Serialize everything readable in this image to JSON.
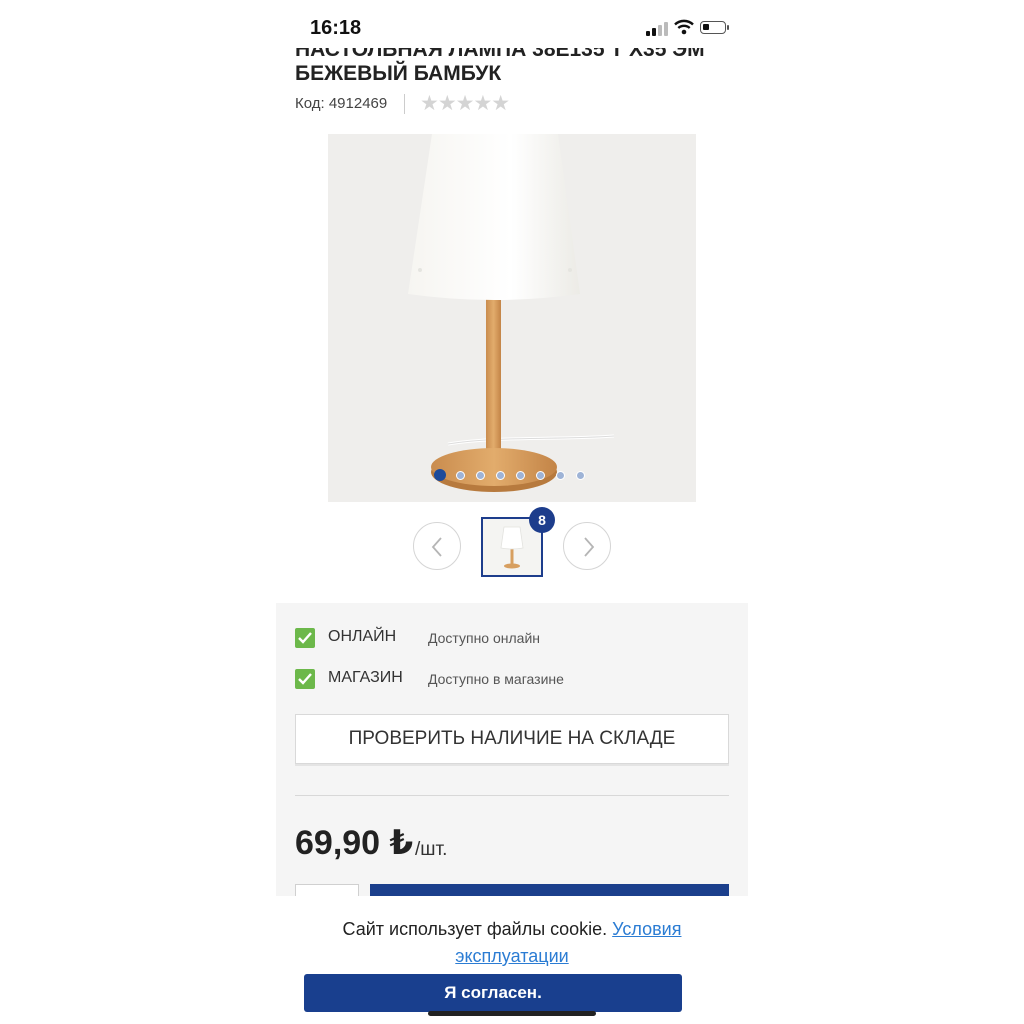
{
  "status_bar": {
    "time": "16:18"
  },
  "product": {
    "title_partial": "НАСТОЛЬНАЯ ЛАМПА 38Е135 Т Х35 ЭМ",
    "title": "БЕЖЕВЫЙ БАМБУК",
    "code": "Код: 4912469",
    "rating": "★★★★★",
    "rating_value": 0,
    "rating_max": 5,
    "image_icon": "table-lamp-image",
    "gallery": {
      "active_index": 0,
      "dot_count": 8,
      "image_count": "8"
    }
  },
  "availability": {
    "items": [
      {
        "label": "ОНЛАЙН",
        "description": "Доступно онлайн",
        "checked": true
      },
      {
        "label": "МАГАЗИН",
        "description": "Доступно в магазине",
        "checked": true
      }
    ],
    "check_stock_label": "ПРОВЕРИТЬ НАЛИЧИЕ НА СКЛАДЕ"
  },
  "price": {
    "value": "69,90 ₺",
    "unit": "/шт."
  },
  "cookie_banner": {
    "text": "Сайт использует файлы cookie. ",
    "link_part1": "Условия",
    "link_part2": "эксплуатации",
    "accept_label": "Я согласен."
  },
  "colors": {
    "accent_blue": "#1b3f8c",
    "check_green": "#6cb84a",
    "link_blue": "#2b7cd3",
    "panel_bg": "#f5f5f5"
  }
}
